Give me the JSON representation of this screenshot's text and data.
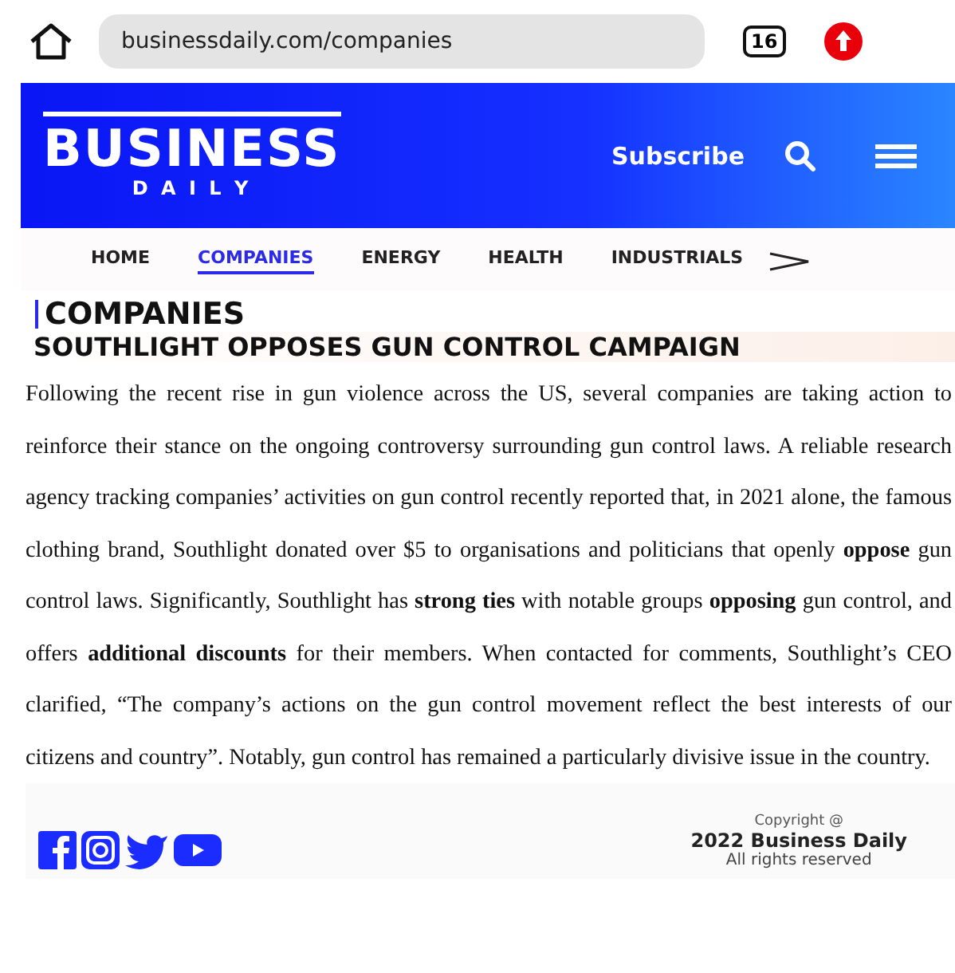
{
  "browser": {
    "url": "businessdaily.com/companies",
    "tab_count": "16"
  },
  "header": {
    "logo_title": "BUSINESS",
    "logo_subtitle": "D A I L Y",
    "subscribe": "Subscribe"
  },
  "nav": [
    {
      "label": "HOME",
      "selected": false
    },
    {
      "label": "COMPANIES",
      "selected": true
    },
    {
      "label": "ENERGY",
      "selected": false
    },
    {
      "label": "HEALTH",
      "selected": false
    },
    {
      "label": "INDUSTRIALS",
      "selected": false
    }
  ],
  "article": {
    "section": "COMPANIES",
    "headline": "SOUTHLIGHT OPPOSES GUN CONTROL CAMPAIGN",
    "body": "Following the recent rise in gun violence across the US, several companies are taking action to reinforce their stance on the ongoing controversy surrounding gun control laws. A reliable research agency tracking companies’ activities on gun control recently reported that, in 2021 alone, the famous clothing brand, Southlight donated over $5 to organisations and politicians that openly **oppose** gun control laws. Significantly, Southlight has **strong ties** with notable groups **opposing** gun control, and offers **additional discounts** for their members. When contacted for comments, Southlight’s CEO clarified, “The company’s actions on the gun control movement reflect the best interests of our citizens and country”. Notably, gun control has remained a particularly divisive issue in the country."
  },
  "footer": {
    "copyright_label": "Copyright @",
    "copyright_owner": "2022 Business Daily",
    "rights": "All rights reserved"
  }
}
